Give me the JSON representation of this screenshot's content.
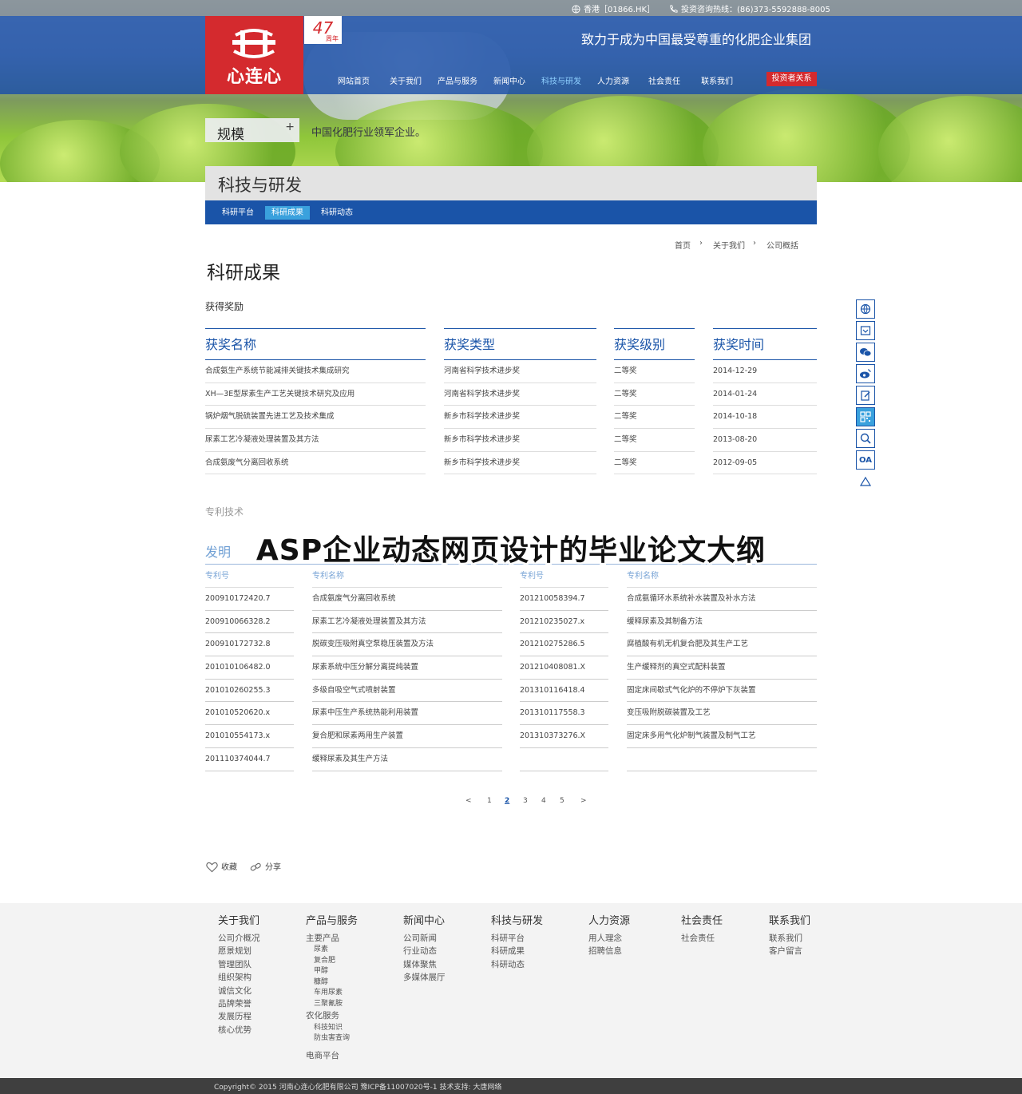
{
  "topbar": {
    "stock": "香港［01866.HK］",
    "hotline": "投资咨询热线：(86)373-5592888-8005"
  },
  "logo": {
    "text": "心连心",
    "anniversary": "47",
    "anniversary_suffix": "周年"
  },
  "slogan": "致力于成为中国最受尊重的化肥企业集团",
  "nav": {
    "items": [
      "网站首页",
      "关于我们",
      "产品与服务",
      "新闻中心",
      "科技与研发",
      "人力资源",
      "社会责任",
      "联系我们"
    ],
    "active_index": 4,
    "investor": "投资者关系"
  },
  "banner": {
    "scale_label": "规模",
    "scale_text": "中国化肥行业领军企业。"
  },
  "section": {
    "title": "科技与研发",
    "subnav": [
      "科研平台",
      "科研成果",
      "科研动态"
    ],
    "subnav_active": 1
  },
  "breadcrumb": [
    "首页",
    "关于我们",
    "公司概括"
  ],
  "page_title": "科研成果",
  "awards": {
    "label": "获得奖励",
    "headers": [
      "获奖名称",
      "获奖类型",
      "获奖级别",
      "获奖时间"
    ],
    "rows": [
      [
        "合成氨生产系统节能减排关键技术集成研究",
        "河南省科学技术进步奖",
        "二等奖",
        "2014-12-29"
      ],
      [
        "XH—3E型尿素生产工艺关键技术研究及应用",
        "河南省科学技术进步奖",
        "二等奖",
        "2014-01-24"
      ],
      [
        "锅炉烟气脱硫装置先进工艺及技术集成",
        "新乡市科学技术进步奖",
        "二等奖",
        "2014-10-18"
      ],
      [
        "尿素工艺冷凝液处理装置及其方法",
        "新乡市科学技术进步奖",
        "二等奖",
        "2013-08-20"
      ],
      [
        "合成氨废气分离回收系统",
        "新乡市科学技术进步奖",
        "二等奖",
        "2012-09-05"
      ]
    ]
  },
  "patents": {
    "label": "专利技术",
    "tab": "发明",
    "headers": [
      "专利号",
      "专利名称",
      "专利号",
      "专利名称"
    ],
    "left_rows": [
      [
        "200910172420.7",
        "合成氨废气分离回收系统"
      ],
      [
        "200910066328.2",
        "尿素工艺冷凝液处理装置及其方法"
      ],
      [
        "200910172732.8",
        "脱碳变压吸附真空泵稳压装置及方法"
      ],
      [
        "201010106482.0",
        "尿素系统中压分解分离提纯装置"
      ],
      [
        "201010260255.3",
        "多级自吸空气式喷射装置"
      ],
      [
        "201010520620.x",
        "尿素中压生产系统热能利用装置"
      ],
      [
        "201010554173.x",
        "复合肥和尿素两用生产装置"
      ],
      [
        "201110374044.7",
        "缓释尿素及其生产方法"
      ]
    ],
    "right_rows": [
      [
        "201210058394.7",
        "合成氨循环水系统补水装置及补水方法"
      ],
      [
        "201210235027.x",
        "缓释尿素及其制备方法"
      ],
      [
        "201210275286.5",
        "腐植酸有机无机复合肥及其生产工艺"
      ],
      [
        "201210408081.X",
        "生产缓释剂的真空式配料装置"
      ],
      [
        "201310116418.4",
        "固定床间歇式气化炉的不停炉下灰装置"
      ],
      [
        "201310117558.3",
        "变压吸附脱碳装置及工艺"
      ],
      [
        "201310373276.X",
        "固定床多用气化炉制气装置及制气工艺"
      ]
    ]
  },
  "overlay_title": "ASP企业动态网页设计的毕业论文大纲",
  "pagination": {
    "prev": "<",
    "pages": [
      "1",
      "2",
      "3",
      "4",
      "5"
    ],
    "current": "2",
    "next": ">"
  },
  "tools": {
    "favorite": "收藏",
    "share": "分享"
  },
  "sidebar_icons": [
    "globe-icon",
    "mail-icon",
    "wechat-icon",
    "weibo-icon",
    "edit-icon",
    "qrcode-icon",
    "search-icon",
    "oa-icon",
    "top-arrow-icon"
  ],
  "sidebar_oa": "OA",
  "footer": {
    "columns": [
      {
        "title": "关于我们",
        "links": [
          "公司介概况",
          "愿景规划",
          "管理团队",
          "组织架构",
          "诚信文化",
          "品牌荣誉",
          "发展历程",
          "核心优势"
        ]
      },
      {
        "title": "产品与服务",
        "groups": [
          {
            "name": "主要产品",
            "subs": [
              "尿素",
              "复合肥",
              "甲醇",
              "糠醇",
              "车用尿素",
              "三聚氰胺"
            ]
          },
          {
            "name": "农化服务",
            "subs": [
              "科技知识",
              "防虫害查询"
            ]
          },
          {
            "name": "电商平台",
            "subs": []
          }
        ]
      },
      {
        "title": "新闻中心",
        "links": [
          "公司新闻",
          "行业动态",
          "媒体聚焦",
          "多媒体展厅"
        ]
      },
      {
        "title": "科技与研发",
        "links": [
          "科研平台",
          "科研成果",
          "科研动态"
        ]
      },
      {
        "title": "人力资源",
        "links": [
          "用人理念",
          "招聘信息"
        ]
      },
      {
        "title": "社会责任",
        "links": [
          "社会责任"
        ]
      },
      {
        "title": "联系我们",
        "links": [
          "联系我们",
          "客户留言"
        ]
      }
    ],
    "copyright": "Copyright© 2015  河南心连心化肥有限公司   豫ICP备11007020号-1     技术支持: 大唐网络"
  },
  "colors": {
    "brand_blue": "#1a54a8",
    "brand_red": "#d42a2e",
    "accent_cyan": "#3aa1dd"
  }
}
